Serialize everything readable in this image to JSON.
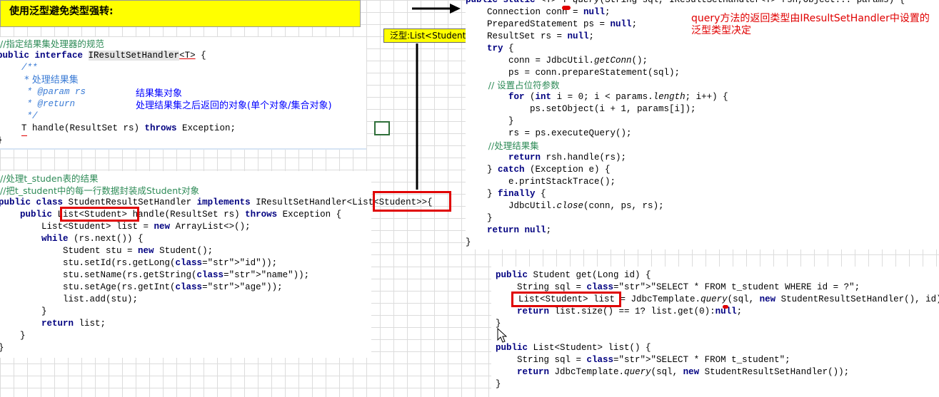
{
  "title_banner": "使用泛型避免类型强转:",
  "generic_label": "泛型:List<Student>",
  "annotation_right": "query方法的返回类型由IResultSetHandler中设置的泛型类型决定",
  "annot_result": "结果集对象",
  "annot_return": "处理结果集之后返回的对象(单个对象/集合对象)",
  "iface": {
    "comment": "//指定结果集处理器的规范",
    "decl_kw": "public interface ",
    "decl_name": "IResultSetHandler",
    "decl_generic": "<T>",
    "decl_tail": " {",
    "doc_open": "/**",
    "doc_line1": " * 处理结果集",
    "doc_param": " * @param rs",
    "doc_return": " * @return",
    "doc_close": " */",
    "method": "T handle(ResultSet rs) throws Exception;",
    "close": "}"
  },
  "impl": {
    "comment1": "//处理t_studen表的结果",
    "comment2": "//把t_student中的每一行数据封装成Student对象",
    "decl": "public class StudentResultSetHandler implements IResultSetHandler",
    "decl_generic": "<List<Student>>",
    "decl_tail": "{",
    "m_pre": "    public ",
    "m_type": "List<Student>",
    "m_post": " handle(ResultSet rs) throws Exception {",
    "l1": "        List<Student> list = new ArrayList<>();",
    "l2": "        while (rs.next()) {",
    "l3": "            Student stu = new Student();",
    "l4": "            stu.setId(rs.getLong(\"id\"));",
    "l5": "            stu.setName(rs.getString(\"name\"));",
    "l6": "            stu.setAge(rs.getInt(\"age\"));",
    "l7": "            list.add(stu);",
    "l8": "        }",
    "l9": "        return list;",
    "l10": "    }",
    "l11": "}"
  },
  "query": {
    "l0": "public static <T> T query(String sql, IResultSetHandler<T> rsh,Object... params) {",
    "l1": "    Connection conn = null;",
    "l2": "    PreparedStatement ps = null;",
    "l3": "    ResultSet rs = null;",
    "l4": "    try {",
    "l5": "        conn = JdbcUtil.getConn();",
    "l6": "        ps = conn.prepareStatement(sql);",
    "l7": "        // 设置占位符参数",
    "l8": "        for (int i = 0; i < params.length; i++) {",
    "l9": "            ps.setObject(i + 1, params[i]);",
    "l10": "        }",
    "l11": "        rs = ps.executeQuery();",
    "l12": "        //处理结果集",
    "l13": "        return rsh.handle(rs);",
    "l14": "    } catch (Exception e) {",
    "l15": "        e.printStackTrace();",
    "l16": "    } finally {",
    "l17": "        JdbcUtil.close(conn, ps, rs);",
    "l18": "    }",
    "l19": "    return null;",
    "l20": "}"
  },
  "dao": {
    "l1": "public Student get(Long id) {",
    "l2": "    String sql = \"SELECT * FROM t_student WHERE id = ?\";",
    "l3_box": "List<Student> list",
    "l3_rest": " = JdbcTemplate.query(sql, new StudentResultSetHandler(), id);",
    "l4": "    return list.size() == 1? list.get(0):null;",
    "l5": "}",
    "l6": "public List<Student> list() {",
    "l7": "    String sql = \"SELECT * FROM t_student\";",
    "l8": "    return JdbcTemplate.query(sql, new StudentResultSetHandler());",
    "l9": "}"
  },
  "colors": {
    "banner_bg": "#ffff00",
    "box_red": "#e00000",
    "annotation_red": "#e00000",
    "annotation_blue": "#0000ff",
    "keyword": "#000080",
    "string": "#0000c0"
  }
}
